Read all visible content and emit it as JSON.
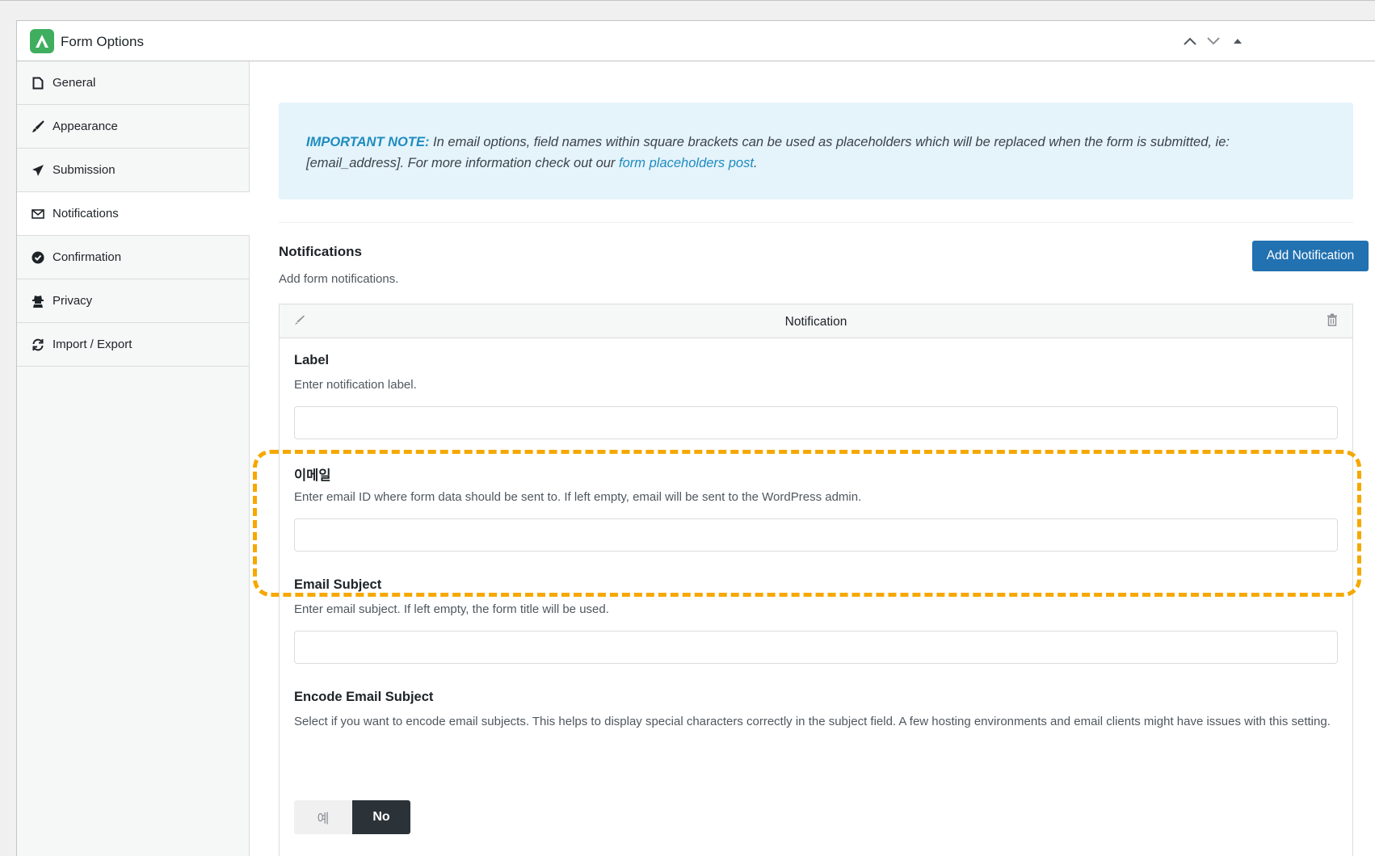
{
  "panel": {
    "title": "Form Options"
  },
  "sidebar": {
    "items": [
      {
        "label": "General",
        "icon": "file-icon"
      },
      {
        "label": "Appearance",
        "icon": "brush-icon"
      },
      {
        "label": "Submission",
        "icon": "paper-plane-icon"
      },
      {
        "label": "Notifications",
        "icon": "envelope-icon",
        "active": true
      },
      {
        "label": "Confirmation",
        "icon": "check-badge-icon"
      },
      {
        "label": "Privacy",
        "icon": "user-secret-icon"
      },
      {
        "label": "Import / Export",
        "icon": "sync-icon"
      }
    ]
  },
  "note": {
    "strong": "IMPORTANT NOTE:",
    "text1": " In email options, field names within square brackets can be used as placeholders which will be replaced when the form is submitted, ie: [email_address]. For more information check out our ",
    "link": "form placeholders post",
    "text2": "."
  },
  "notifications": {
    "title": "Notifications",
    "description": "Add form notifications.",
    "add_button": "Add Notification"
  },
  "notification": {
    "header": "Notification",
    "fields": {
      "label": {
        "label": "Label",
        "description": "Enter notification label.",
        "value": ""
      },
      "email": {
        "label": "이메일",
        "description": "Enter email ID where form data should be sent to. If left empty, email will be sent to the WordPress admin.",
        "value": ""
      },
      "subject": {
        "label": "Email Subject",
        "description": "Enter email subject. If left empty, the form title will be used.",
        "value": ""
      },
      "encode": {
        "label": "Encode Email Subject",
        "description": "Select if you want to encode email subjects. This helps to display special characters correctly in the subject field. A few hosting environments and email clients might have issues with this setting.",
        "yes": "예",
        "no": "No",
        "selected": "No"
      }
    }
  },
  "colors": {
    "accent": "#2271b1",
    "highlight": "#f5a800",
    "note_bg": "#e5f3fb",
    "logo": "#3fae5f"
  }
}
